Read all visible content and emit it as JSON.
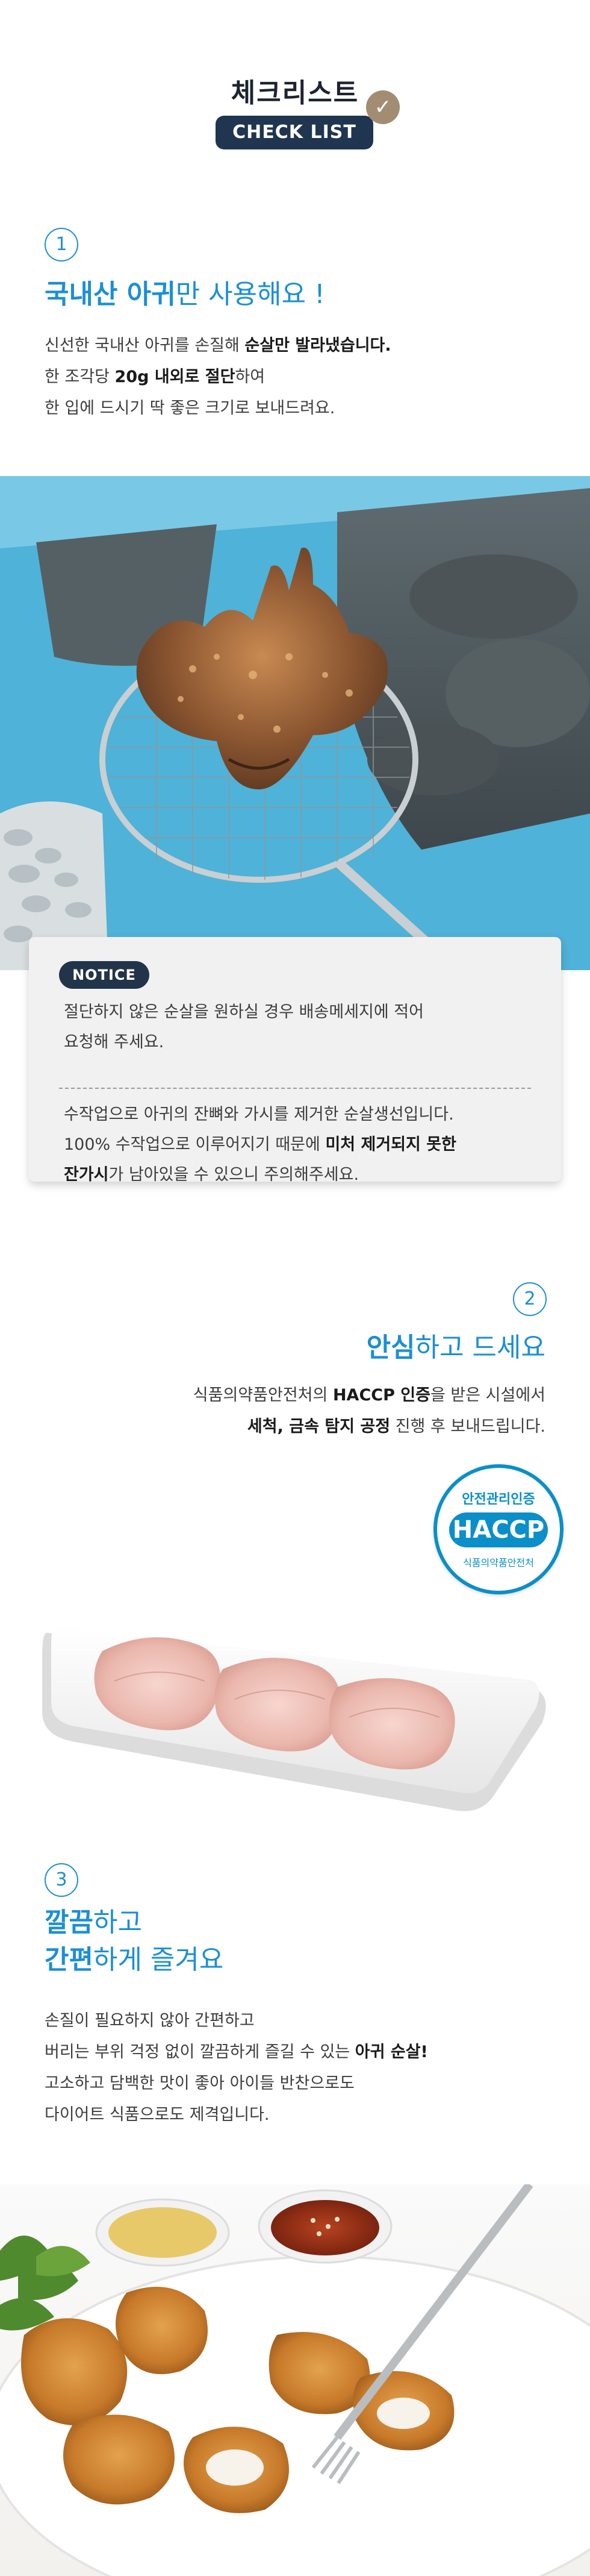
{
  "header": {
    "title": "체크리스트",
    "badge": "CHECK LIST",
    "check_icon": "check-circle-icon"
  },
  "section1": {
    "number": "1",
    "heading_bold": "국내산 아귀",
    "heading_rest": "만 사용해요 !",
    "lines": [
      {
        "pre": "신선한 국내산 아귀를 손질해 ",
        "bold": "순살만 발라냈습니다.",
        "post": ""
      },
      {
        "pre": "한 조각당 ",
        "bold": "20g 내외로 절단",
        "post": "하여"
      },
      {
        "pre": "한 입에 드시기 딱 좋은 크기로 보내드려요.",
        "bold": "",
        "post": ""
      }
    ]
  },
  "notice": {
    "badge": "NOTICE",
    "para1": [
      "절단하지 않은 순살을 원하실 경우 배송메세지에 적어",
      "요청해 주세요."
    ],
    "para2_line1": "수작업으로 아귀의 잔뼈와 가시를 제거한 순살생선입니다.",
    "para2_line2_pre": "100% 수작업으로 이루어지기 때문에 ",
    "para2_line2_bold": "미처 제거되지 못한",
    "para2_line3_bold": "잔가시",
    "para2_line3_post": "가 남아있을 수 있으니 주의해주세요."
  },
  "section2": {
    "number": "2",
    "heading_bold": "안심",
    "heading_rest": "하고 드세요",
    "line1_pre": "식품의약품안전처의 ",
    "line1_bold": "HACCP 인증",
    "line1_post": "을 받은 시설에서",
    "line2_bold": "세척, 금속 탐지 공정",
    "line2_post": " 진행 후 보내드립니다."
  },
  "haccp": {
    "top": "안전관리인증",
    "main": "HACCP",
    "bottom": "식품의약품안전처"
  },
  "section3": {
    "number": "3",
    "heading1_bold": "깔끔",
    "heading1_rest": "하고",
    "heading2_bold": "간편",
    "heading2_rest": "하게 즐겨요",
    "lines": [
      {
        "pre": "손질이 필요하지 않아 간편하고",
        "bold": ""
      },
      {
        "pre": "버리는 부위 걱정 없이 깔끔하게 즐길 수 있는 ",
        "bold": "아귀 순살!"
      },
      {
        "pre": "고소하고 담백한 맛이 좋아 아이들 반찬으로도",
        "bold": ""
      },
      {
        "pre": "다이어트 식품으로도 제격입니다.",
        "bold": ""
      }
    ]
  },
  "colors": {
    "accent_blue": "#1b8fd4",
    "navy": "#1f3550",
    "haccp_blue": "#0b8fc8"
  }
}
